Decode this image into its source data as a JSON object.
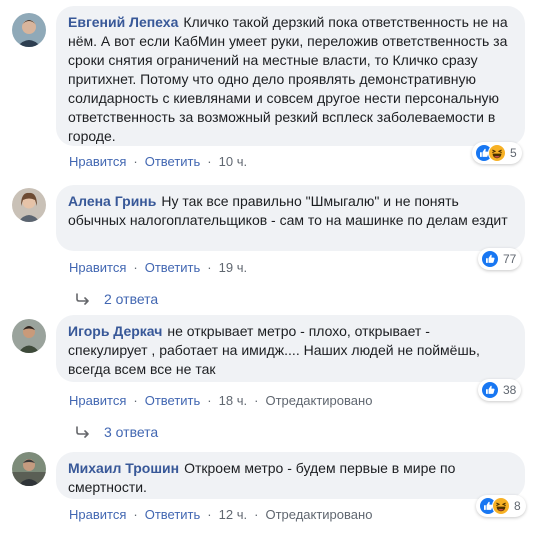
{
  "actions": {
    "like_label": "Нравится",
    "reply_label": "Ответить",
    "edited_label": "Отредактировано"
  },
  "comments": [
    {
      "author": "Евгений Лепеха",
      "text": "Кличко такой дерзкий пока ответственность не на нём. А вот если КабМин умеет руки, переложив ответственность за сроки снятия ограничений на местные власти, то Кличко сразу притихнет. Потому что одно дело проявлять демонстративную солидарность с киевлянами и совсем другое нести персональную ответственность за возможный резкий всплеск заболеваемости в городе.",
      "time": "10 ч.",
      "reactions": [
        "like",
        "haha"
      ],
      "reaction_count": "5"
    },
    {
      "author": "Алена Гринь",
      "text": "Ну так все правильно \"Шмыгалю\" и не понять обычных налогоплательщиков - сам то на машинке по делам ездит",
      "time": "19 ч.",
      "reactions": [
        "like"
      ],
      "reaction_count": "77",
      "replies_label": "2 ответа"
    },
    {
      "author": "Игорь Деркач",
      "text": "не открывает метро - плохо, открывает - спекулирует , работает на имидж.... Наших людей не поймёшь, всегда всем все не так",
      "time": "18 ч.",
      "edited": true,
      "reactions": [
        "like"
      ],
      "reaction_count": "38",
      "replies_label": "3 ответа"
    },
    {
      "author": "Михаил Трошин",
      "text": "Откроем метро - будем первые в мире по смертности.",
      "time": "12 ч.",
      "edited": true,
      "reactions": [
        "like",
        "haha"
      ],
      "reaction_count": "8"
    }
  ],
  "colors": {
    "link": "#385898",
    "action": "#4267b2",
    "bubble": "#f0f2f5",
    "like": "#1877f2",
    "haha": "#f7b125"
  }
}
